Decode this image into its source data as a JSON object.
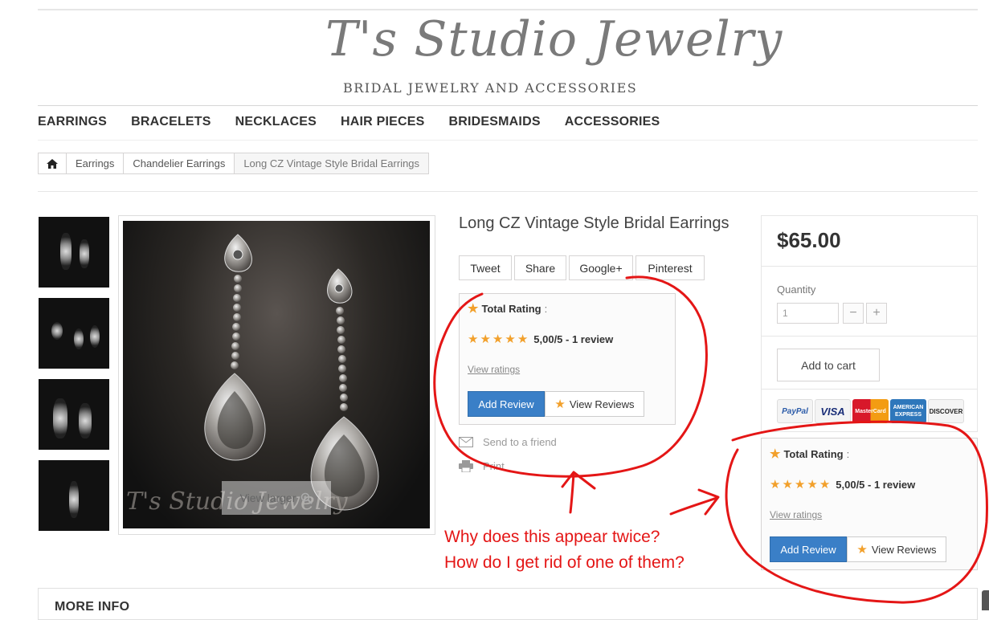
{
  "logo": {
    "title": "T's Studio Jewelry",
    "tagline": "BRIDAL JEWELRY AND ACCESSORIES"
  },
  "nav": [
    "EARRINGS",
    "BRACELETS",
    "NECKLACES",
    "HAIR PIECES",
    "BRIDESMAIDS",
    "ACCESSORIES"
  ],
  "breadcrumb": {
    "home_icon": "home-icon",
    "items": [
      "Earrings",
      "Chandelier Earrings",
      "Long CZ Vintage Style Bridal Earrings"
    ]
  },
  "product": {
    "title": "Long CZ Vintage Style Bridal Earrings",
    "view_larger": "View larger",
    "watermark": "T's Studio Jewelry",
    "share": [
      "Tweet",
      "Share",
      "Google+",
      "Pinterest"
    ],
    "send_to_friend": "Send to a friend",
    "print": "Print"
  },
  "rating": {
    "title": "Total Rating",
    "colon": ":",
    "stars": 5,
    "score": "5,00/5 - 1 review",
    "view_ratings": "View ratings",
    "add_review": "Add Review",
    "view_reviews": "View Reviews"
  },
  "buy": {
    "price": "$65.00",
    "quantity_label": "Quantity",
    "quantity_value": "1",
    "minus": "−",
    "plus": "+",
    "add_to_cart": "Add to cart",
    "payments": [
      "PayPal",
      "VISA",
      "MasterCard",
      "AMERICAN EXPRESS",
      "DISCOVER"
    ]
  },
  "more_info": "MORE INFO",
  "annotation": {
    "line1": "Why does this appear twice?",
    "line2": "How do I get rid of one of them?",
    "color": "#e41616"
  }
}
